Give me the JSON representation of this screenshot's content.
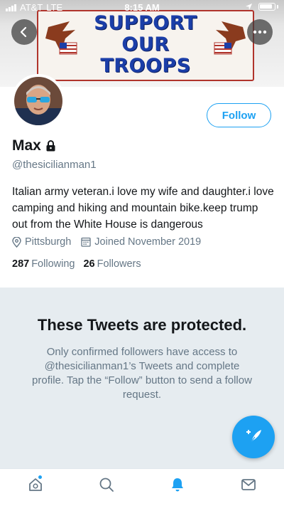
{
  "status_bar": {
    "carrier": "AT&T",
    "network": "LTE",
    "time": "8:15 AM"
  },
  "banner": {
    "text_lines": [
      "SUPPORT",
      "OUR",
      "TROOPS"
    ]
  },
  "profile": {
    "avatar_icon": "profile-photo",
    "follow_label": "Follow",
    "display_name": "Max",
    "handle": "@thesicilianman1",
    "bio": "Italian army veteran.i love my wife and daughter.i love camping and hiking and mountain bike.keep trump out from the White House is dangerous",
    "location": "Pittsburgh",
    "joined": "Joined November 2019",
    "following_count": "287",
    "following_label": "Following",
    "followers_count": "26",
    "followers_label": "Followers"
  },
  "protected": {
    "title": "These Tweets are protected.",
    "description": "Only confirmed followers have access to @thesicilianman1’s Tweets and complete profile. Tap the “Follow” button to send a follow request."
  },
  "tab_bar": {
    "items": [
      {
        "icon": "home-icon",
        "active": false,
        "has_dot": true
      },
      {
        "icon": "search-icon",
        "active": false
      },
      {
        "icon": "notifications-icon",
        "active": true
      },
      {
        "icon": "messages-icon",
        "active": false
      }
    ]
  },
  "colors": {
    "accent": "#1da1f2",
    "secondary_text": "#657786",
    "protected_bg": "#e6ecf0"
  }
}
